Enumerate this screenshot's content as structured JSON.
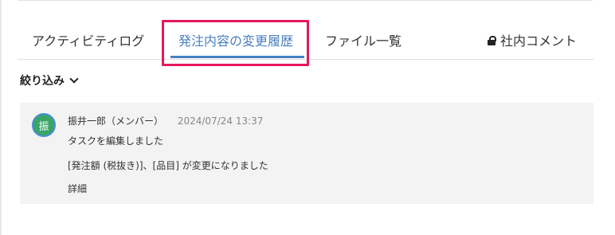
{
  "tabs": [
    {
      "label": "アクティビティログ"
    },
    {
      "label": "発注内容の変更履歴",
      "active": true
    },
    {
      "label": "ファイル一覧"
    },
    {
      "label": "社内コメント",
      "icon": "lock-icon"
    }
  ],
  "filter": {
    "label": "絞り込み",
    "icon": "chevron-down-icon"
  },
  "entry": {
    "avatar_char": "振",
    "author": "振井一郎（メンバー）",
    "timestamp": "2024/07/24 13:37",
    "action": "タスクを編集しました",
    "change": "[発注額 (税抜き)]、[品目] が変更になりました",
    "details": "詳細"
  },
  "colors": {
    "accent": "#4a7fc1",
    "highlight": "#e5175c",
    "avatar_bg": "#39a567",
    "card_bg": "#f3f3f3"
  }
}
